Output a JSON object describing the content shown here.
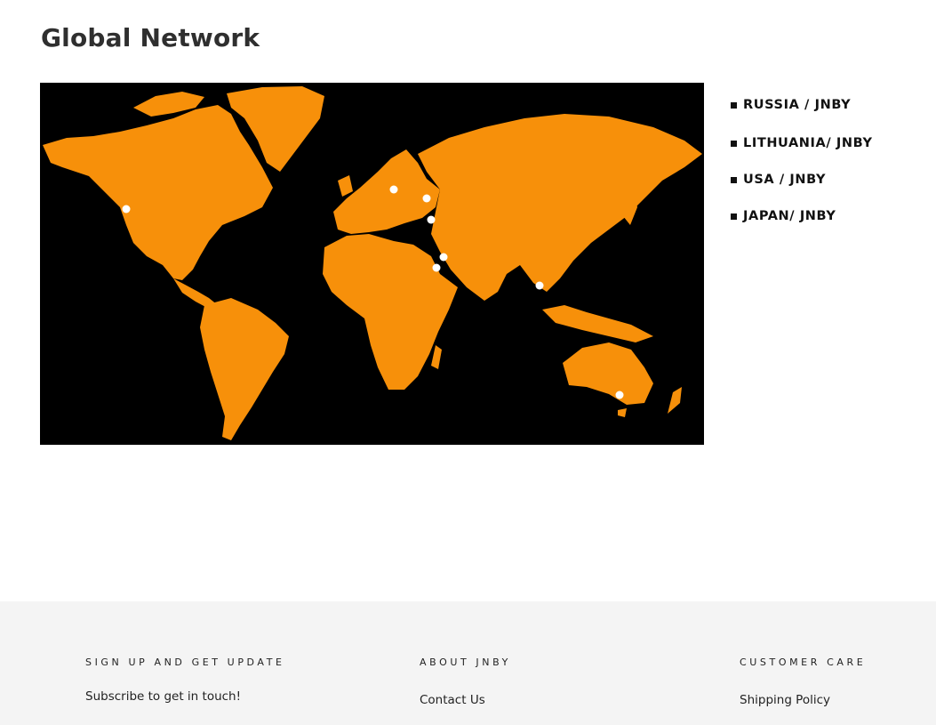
{
  "page": {
    "title": "Global Network"
  },
  "map": {
    "colors": {
      "ocean": "#000000",
      "land": "#f7900a",
      "marker": "#ffffff"
    }
  },
  "locations": [
    {
      "label": "RUSSIA / JNBY"
    },
    {
      "label": "LITHUANIA/ JNBY"
    },
    {
      "label": "USA / JNBY"
    },
    {
      "label": "JAPAN/ JNBY"
    }
  ],
  "footer": {
    "signup": {
      "heading": "SIGN UP AND GET UPDATE",
      "text": "Subscribe to get in touch!"
    },
    "about": {
      "heading": "ABOUT JNBY",
      "link": "Contact Us"
    },
    "care": {
      "heading": "CUSTOMER CARE",
      "link": "Shipping Policy"
    }
  }
}
